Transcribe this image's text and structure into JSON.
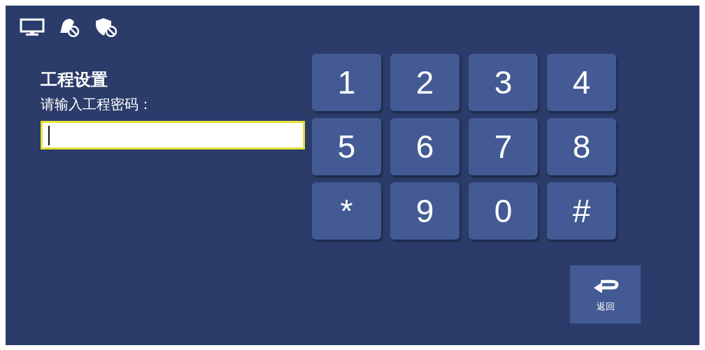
{
  "title": "工程设置",
  "prompt": "请输入工程密码：",
  "password_field": {
    "focused": true
  },
  "keypad": [
    {
      "label": "1"
    },
    {
      "label": "2"
    },
    {
      "label": "3"
    },
    {
      "label": "4"
    },
    {
      "label": "5"
    },
    {
      "label": "6"
    },
    {
      "label": "7"
    },
    {
      "label": "8"
    },
    {
      "label": "*"
    },
    {
      "label": "9"
    },
    {
      "label": "0"
    },
    {
      "label": "#"
    }
  ],
  "back_button": {
    "label": "返回"
  }
}
